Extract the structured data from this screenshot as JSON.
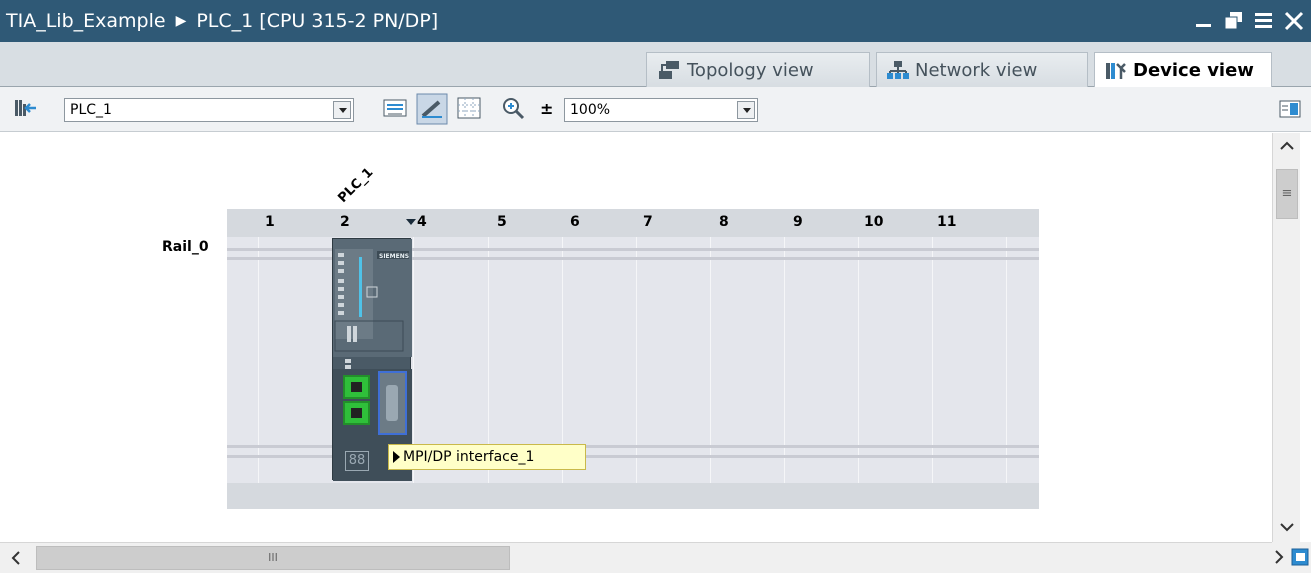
{
  "window": {
    "project": "TIA_Lib_Example",
    "separator": "▶",
    "device": "PLC_1 [CPU 315-2 PN/DP]",
    "controls": [
      "minimize-icon",
      "restore-icon",
      "maximize-icon",
      "close-icon"
    ]
  },
  "tabs": [
    {
      "label": "Topology view",
      "icon": "topology-icon",
      "active": false
    },
    {
      "label": "Network view",
      "icon": "network-icon",
      "active": false
    },
    {
      "label": "Device view",
      "icon": "device-icon",
      "active": true
    }
  ],
  "toolbar": {
    "device_select": "PLC_1",
    "zoom_select": "100%",
    "zoom_step": "±"
  },
  "canvas": {
    "rack_name": "PLC_1",
    "rail_label": "Rail_0",
    "slots": [
      "1",
      "2",
      "4",
      "5",
      "6",
      "7",
      "8",
      "9",
      "10",
      "11"
    ],
    "cpu_brand": "SIEMENS",
    "tooltip": "MPI/DP interface_1"
  },
  "scrollbars": {
    "horizontal_grip": "III",
    "vertical_grip": "≡"
  },
  "colors": {
    "titlebar": "#2f5976",
    "tooltip_bg": "#ffffc8",
    "port_green": "#2fbf3a",
    "port_selected": "#3f6fd6"
  }
}
